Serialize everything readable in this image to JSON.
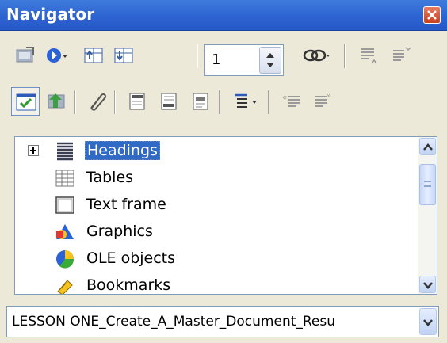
{
  "window": {
    "title": "Navigator",
    "close_icon": "close-icon"
  },
  "toolbar1": {
    "page_number": "1",
    "buttons": [
      "toggle-icon",
      "navigation-icon",
      "previous-icon",
      "next-icon",
      "drag-mode-icon",
      "promote-level-icon",
      "demote-level-icon"
    ]
  },
  "toolbar2": {
    "buttons": [
      "content-view-icon",
      "headings-icon",
      "reminder-icon",
      "header-icon",
      "footer-icon",
      "anchor-to-text-icon",
      "heading-levels-icon",
      "promote-chapter-icon",
      "demote-chapter-icon"
    ]
  },
  "tree": {
    "items": [
      {
        "label": "Headings",
        "icon": "headings-icon",
        "selected": true,
        "expandable": true
      },
      {
        "label": "Tables",
        "icon": "tables-icon",
        "selected": false,
        "expandable": false
      },
      {
        "label": "Text frame",
        "icon": "text-frame-icon",
        "selected": false,
        "expandable": false
      },
      {
        "label": "Graphics",
        "icon": "graphics-icon",
        "selected": false,
        "expandable": false
      },
      {
        "label": "OLE objects",
        "icon": "ole-objects-icon",
        "selected": false,
        "expandable": false
      },
      {
        "label": "Bookmarks",
        "icon": "bookmarks-icon",
        "selected": false,
        "expandable": false
      }
    ]
  },
  "document_selector": {
    "value": "LESSON ONE_Create_A_Master_Document_Resu"
  },
  "colors": {
    "titlebar": "#2E64D2",
    "selection": "#316AC5",
    "background": "#ECE9D8"
  }
}
